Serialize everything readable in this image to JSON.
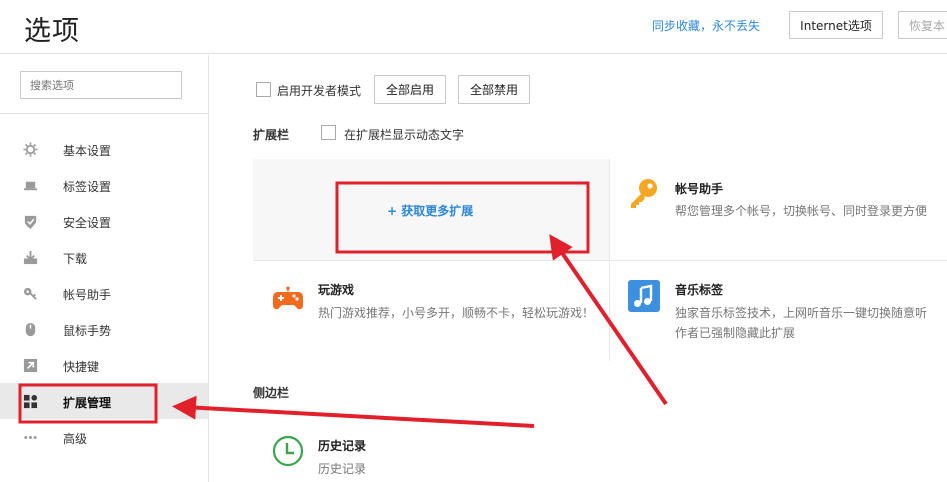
{
  "header": {
    "title": "选项",
    "sync_text": "同步收藏，永不丢失",
    "internet_button": "Internet选项",
    "restore_button": "恢复本"
  },
  "sidebar": {
    "search_placeholder": "搜索选项",
    "items": [
      {
        "label": "基本设置",
        "icon": "gear-icon"
      },
      {
        "label": "标签设置",
        "icon": "tab-icon"
      },
      {
        "label": "安全设置",
        "icon": "shield-icon"
      },
      {
        "label": "下载",
        "icon": "download-icon"
      },
      {
        "label": "帐号助手",
        "icon": "key-icon"
      },
      {
        "label": "鼠标手势",
        "icon": "mouse-icon"
      },
      {
        "label": "快捷键",
        "icon": "shortcut-icon"
      },
      {
        "label": "扩展管理",
        "icon": "grid-icon",
        "active": true
      },
      {
        "label": "高级",
        "icon": "more-icon"
      }
    ]
  },
  "main": {
    "dev_mode_label": "启用开发者模式",
    "enable_all": "全部启用",
    "disable_all": "全部禁用",
    "extension_bar_title": "扩展栏",
    "show_dynamic_text_label": "在扩展栏显示动态文字",
    "get_more": "+ 获取更多扩展",
    "extensions": [
      {
        "title": "帐号助手",
        "desc": "帮您管理多个帐号，切换帐号、同时登录更方便",
        "icon": "key-icon",
        "color": "#f5a623"
      },
      {
        "title": "玩游戏",
        "desc": "热门游戏推荐，小号多开，顺畅不卡，轻松玩游戏！",
        "icon": "gamepad-icon",
        "color": "#f26b1d"
      },
      {
        "title": "音乐标签",
        "desc_line1": "独家音乐标签技术，上网听音乐一键切换随意听",
        "desc_line2": "作者已强制隐藏此扩展",
        "icon": "music-icon",
        "color": "#3d8fe0"
      }
    ],
    "sidebar_section_title": "侧边栏",
    "history": {
      "title": "历史记录",
      "desc": "历史记录",
      "icon": "clock-icon",
      "color": "#3aa54a"
    }
  },
  "annotations": {
    "box_color": "#e0202a",
    "arrow_color": "#e0202a"
  }
}
